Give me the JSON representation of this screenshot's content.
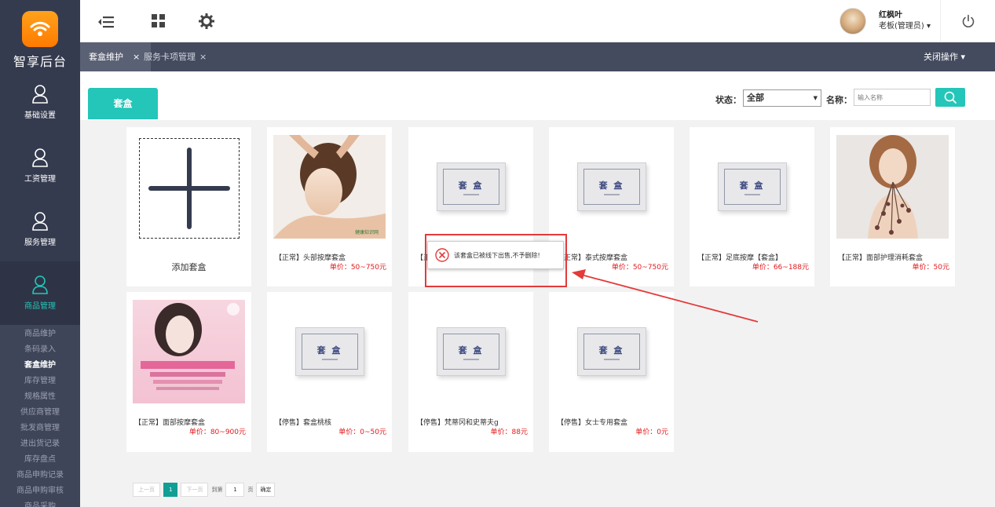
{
  "app": {
    "logo_text": "智享后台",
    "brand_color": "#23c6b8",
    "sidebar_bg": "#353b4f"
  },
  "sidebar": {
    "menu": [
      {
        "label": "基础设置",
        "icon": "user-icon"
      },
      {
        "label": "工资管理",
        "icon": "user-icon"
      },
      {
        "label": "服务管理",
        "icon": "user-icon"
      },
      {
        "label": "商品管理",
        "icon": "user-icon",
        "active": true
      }
    ],
    "submenu": [
      "商品维护",
      "条码录入",
      "套盒维护",
      "库存管理",
      "规格属性",
      "供应商管理",
      "批发商管理",
      "进出货记录",
      "库存盘点",
      "商品申购记录",
      "商品申购审核",
      "商品采购"
    ]
  },
  "topbar": {
    "icons": [
      "menu-collapse-icon",
      "grid-icon",
      "gear-icon",
      "power-icon"
    ],
    "user_name": "红枫叶",
    "user_role": "老板(管理员) ▾"
  },
  "tabs": [
    {
      "label": "套盒维护",
      "active": true,
      "close": "×"
    },
    {
      "label": "服务卡项管理",
      "close": "×"
    }
  ],
  "close_ops": "关闭操作 ▾",
  "toolbar": {
    "tab_label": "套盒",
    "status_label": "状态：",
    "status_value": "全部",
    "name_label": "名称：",
    "name_placeholder": "输入名称"
  },
  "add_card": {
    "label": "添加套盒"
  },
  "products": [
    {
      "name": "【正常】头部按摩套盒",
      "price": "单价：50~750元",
      "image": "photo"
    },
    {
      "name": "【正常】",
      "price": "",
      "image": "box"
    },
    {
      "name": "【正常】泰式按摩套盒",
      "price": "单价：50~750元",
      "image": "box"
    },
    {
      "name": "【正常】足底按摩【套盒】",
      "price": "单价：66~188元",
      "image": "box"
    },
    {
      "name": "【正常】面部护理消耗套盒",
      "price": "单价：50元",
      "image": "photo"
    },
    {
      "name": "【正常】面部按摩套盒",
      "price": "单价：80~900元",
      "image": "poster"
    },
    {
      "name": "【停售】套盒桃核",
      "price": "单价：0~50元",
      "image": "box"
    },
    {
      "name": "【停售】梵蒂冈和史蒂夫g",
      "price": "单价：88元",
      "image": "box"
    },
    {
      "name": "【停售】女士专用套盒",
      "price": "单价：0元",
      "image": "box"
    }
  ],
  "box_text": "套 盒",
  "photo_watermark": "健康知识网",
  "pager": {
    "prev": "上一页",
    "current": "1",
    "next": "下一页",
    "goto": "到第",
    "page_input": "1",
    "page_unit": "页",
    "confirm": "确定"
  },
  "toast": {
    "message": "该套盒已被线下出售,不予删除!",
    "error_color": "#e43a3a"
  }
}
